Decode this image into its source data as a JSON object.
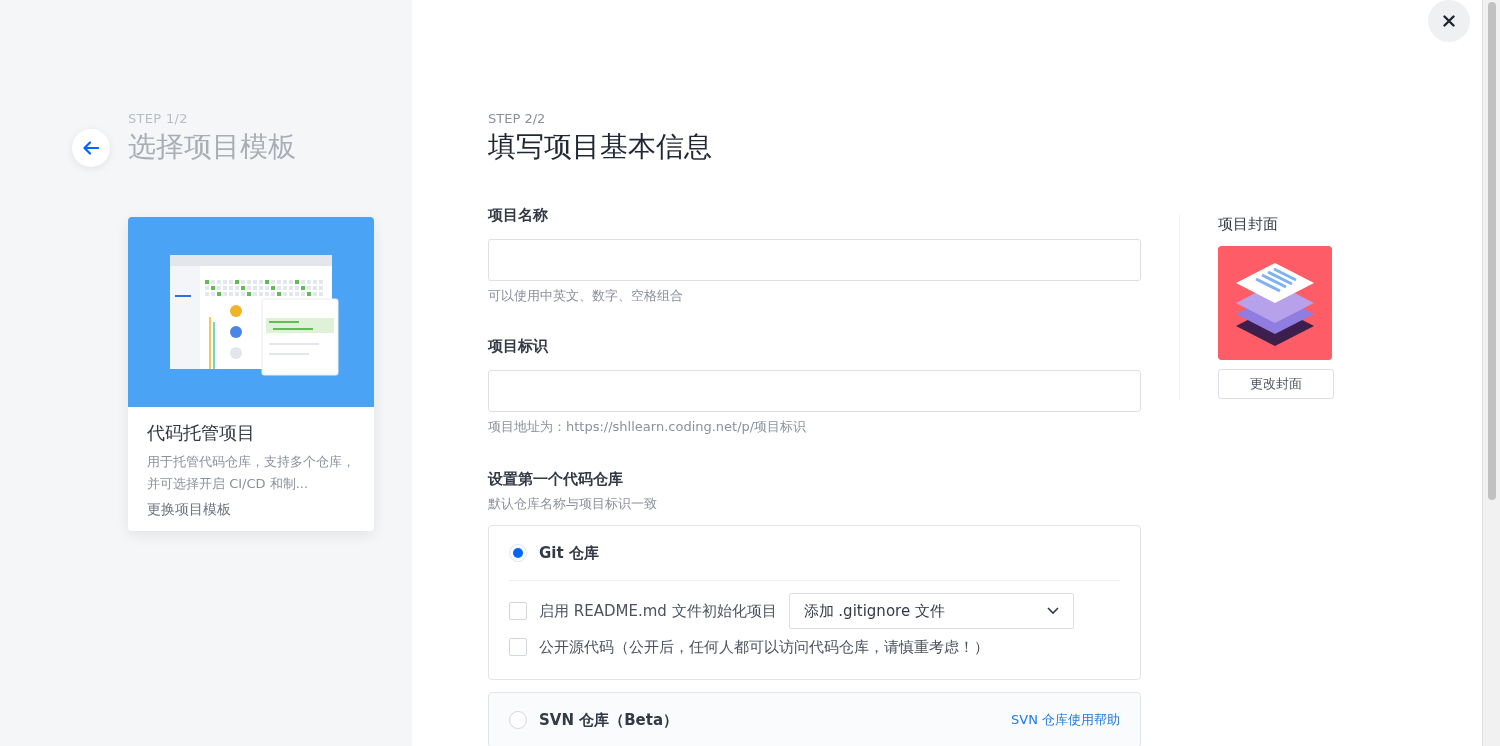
{
  "left_panel": {
    "step": "STEP 1/2",
    "title": "选择项目模板",
    "template_card": {
      "title": "代码托管项目",
      "description": "用于托管代码仓库，支持多个仓库，并可选择开启 CI/CD 和制...",
      "link": "更换项目模板"
    }
  },
  "form": {
    "step": "STEP 2/2",
    "title": "填写项目基本信息",
    "fields": [
      {
        "label": "项目名称",
        "hint": "可以使用中英文、数字、空格组合"
      },
      {
        "label": "项目标识",
        "hint": "项目地址为：https://shllearn.coding.net/p/项目标识"
      }
    ],
    "repository": {
      "label": "设置第一个代码仓库",
      "hint": "默认仓库名称与项目标识一致",
      "options": [
        {
          "kind": "git",
          "label": "Git 仓库",
          "selected": true,
          "checkboxes": [
            {
              "label": "启用 README.md 文件初始化项目",
              "checked": false
            },
            {
              "label": "公开源代码（公开后，任何人都可以访问代码仓库，请慎重考虑！）",
              "checked": false
            }
          ],
          "dropdown": "添加 .gitignore 文件"
        },
        {
          "kind": "svn",
          "label": "SVN 仓库（Beta）",
          "selected": false,
          "help_link": "SVN 仓库使用帮助"
        }
      ]
    }
  },
  "cover": {
    "label": "项目封面",
    "button": "更改封面"
  }
}
